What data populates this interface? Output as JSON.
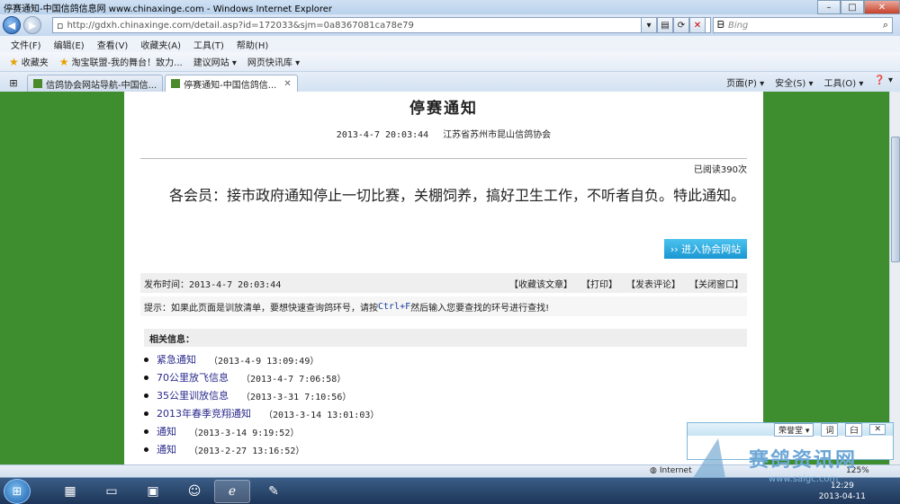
{
  "window": {
    "title": "停赛通知-中国信鸽信息网 www.chinaxinge.com - Windows Internet Explorer",
    "min": "–",
    "max": "□",
    "close": "✕"
  },
  "address": {
    "url": "http://gdxh.chinaxinge.com/detail.asp?id=172033&sjm=0a8367081ca78e79",
    "search_placeholder": "Bing"
  },
  "menu": [
    "文件(F)",
    "编辑(E)",
    "查看(V)",
    "收藏夹(A)",
    "工具(T)",
    "帮助(H)"
  ],
  "favorites": {
    "label": "收藏夹",
    "items": [
      "淘宝联盟-我的舞台！致力...",
      "建议网站 ▾",
      "网页快讯库 ▾"
    ]
  },
  "tabs": [
    "信鸽协会网站导航-中国信...",
    "停赛通知-中国信鸽信..."
  ],
  "tab_tools": [
    "页面(P) ▾",
    "安全(S) ▾",
    "工具(O) ▾",
    "❓ ▾"
  ],
  "article": {
    "title": "停赛通知",
    "datetime": "2013-4-7 20:03:44",
    "source": "江苏省苏州市昆山信鸽协会",
    "reads": "已阅读390次",
    "body": "各会员：接市政府通知停止一切比赛，关棚饲养，搞好卫生工作，不听者自负。特此通知。",
    "enter_button": "›› 进入协会网站",
    "publish_label": "发布时间：2013-4-7 20:03:44",
    "actions": [
      "【收藏该文章】",
      "【打印】",
      "【发表评论】",
      "【关闭窗口】"
    ],
    "tip_prefix": "提示：如果此页面是训放清单，要想快速查询鸽环号，请按",
    "tip_keys": "Ctrl+F",
    "tip_suffix": "然后输入您要查找的环号进行查找!"
  },
  "related": {
    "heading": "相关信息：",
    "items": [
      {
        "title": "紧急通知",
        "date": "（2013-4-9 13:09:49）"
      },
      {
        "title": "70公里放飞信息",
        "date": "（2013-4-7 7:06:58）"
      },
      {
        "title": "35公里训放信息",
        "date": "（2013-3-31 7:10:56）"
      },
      {
        "title": "2013年春季竞翔通知",
        "date": "（2013-3-14 13:01:03）"
      },
      {
        "title": "通知",
        "date": "（2013-3-14 9:19:52）"
      },
      {
        "title": "通知",
        "date": "（2013-2-27 13:16:52）"
      }
    ]
  },
  "status": {
    "zone": "Internet",
    "zoom": "125%"
  },
  "im_widget": {
    "buttons": [
      "荣誉堂 ▾",
      "词",
      "臼",
      "✕"
    ]
  },
  "watermark": {
    "name": "赛鸽资讯网",
    "site": "www.saigc.com"
  },
  "taskbar": {
    "time": "12:29",
    "date": "2013-04-11"
  }
}
